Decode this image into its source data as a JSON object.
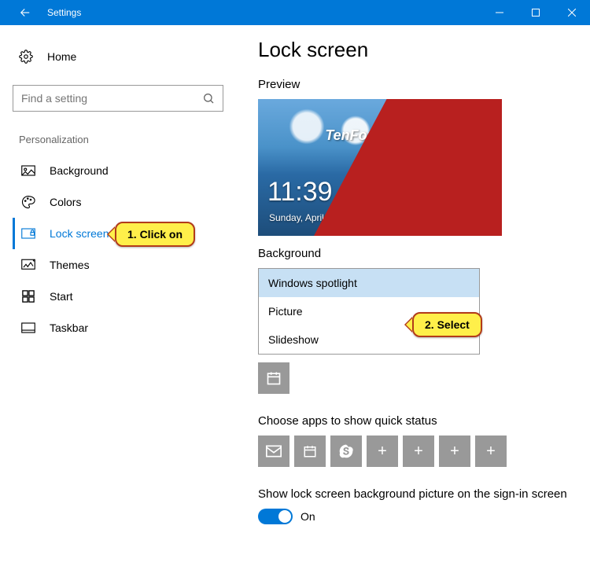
{
  "titlebar": {
    "title": "Settings"
  },
  "sidebar": {
    "home": "Home",
    "search_placeholder": "Find a setting",
    "section": "Personalization",
    "items": [
      {
        "label": "Background"
      },
      {
        "label": "Colors"
      },
      {
        "label": "Lock screen"
      },
      {
        "label": "Themes"
      },
      {
        "label": "Start"
      },
      {
        "label": "Taskbar"
      }
    ]
  },
  "main": {
    "heading": "Lock screen",
    "preview_label": "Preview",
    "preview": {
      "watermark": "TenForums.com",
      "time": "11:39",
      "date": "Sunday, April 16"
    },
    "background_label": "Background",
    "dropdown": {
      "options": [
        "Windows spotlight",
        "Picture",
        "Slideshow"
      ],
      "selected": "Windows spotlight"
    },
    "quick_status_label": "Choose apps to show quick status",
    "signin_label": "Show lock screen background picture on the sign-in screen",
    "toggle_state": "On"
  },
  "annotations": {
    "step1": "1. Click on",
    "step2": "2. Select"
  }
}
